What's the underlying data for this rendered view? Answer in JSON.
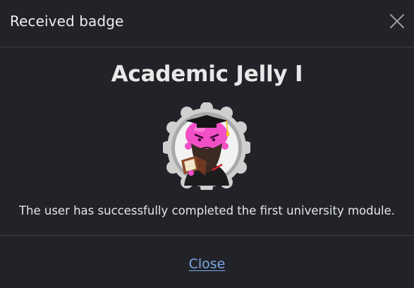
{
  "dialog": {
    "title": "Received badge",
    "close_icon": "close-icon"
  },
  "badge": {
    "name": "Academic Jelly I",
    "description": "The user has successfully completed the first university module.",
    "image_icon": "badge-academic-jelly-image"
  },
  "footer": {
    "close_label": "Close"
  },
  "colors": {
    "background": "#212328",
    "divider": "#3d3f44",
    "link": "#7ba7e8",
    "jelly_pink": "#f04fc6",
    "badge_ring": "#b5b5b5"
  }
}
